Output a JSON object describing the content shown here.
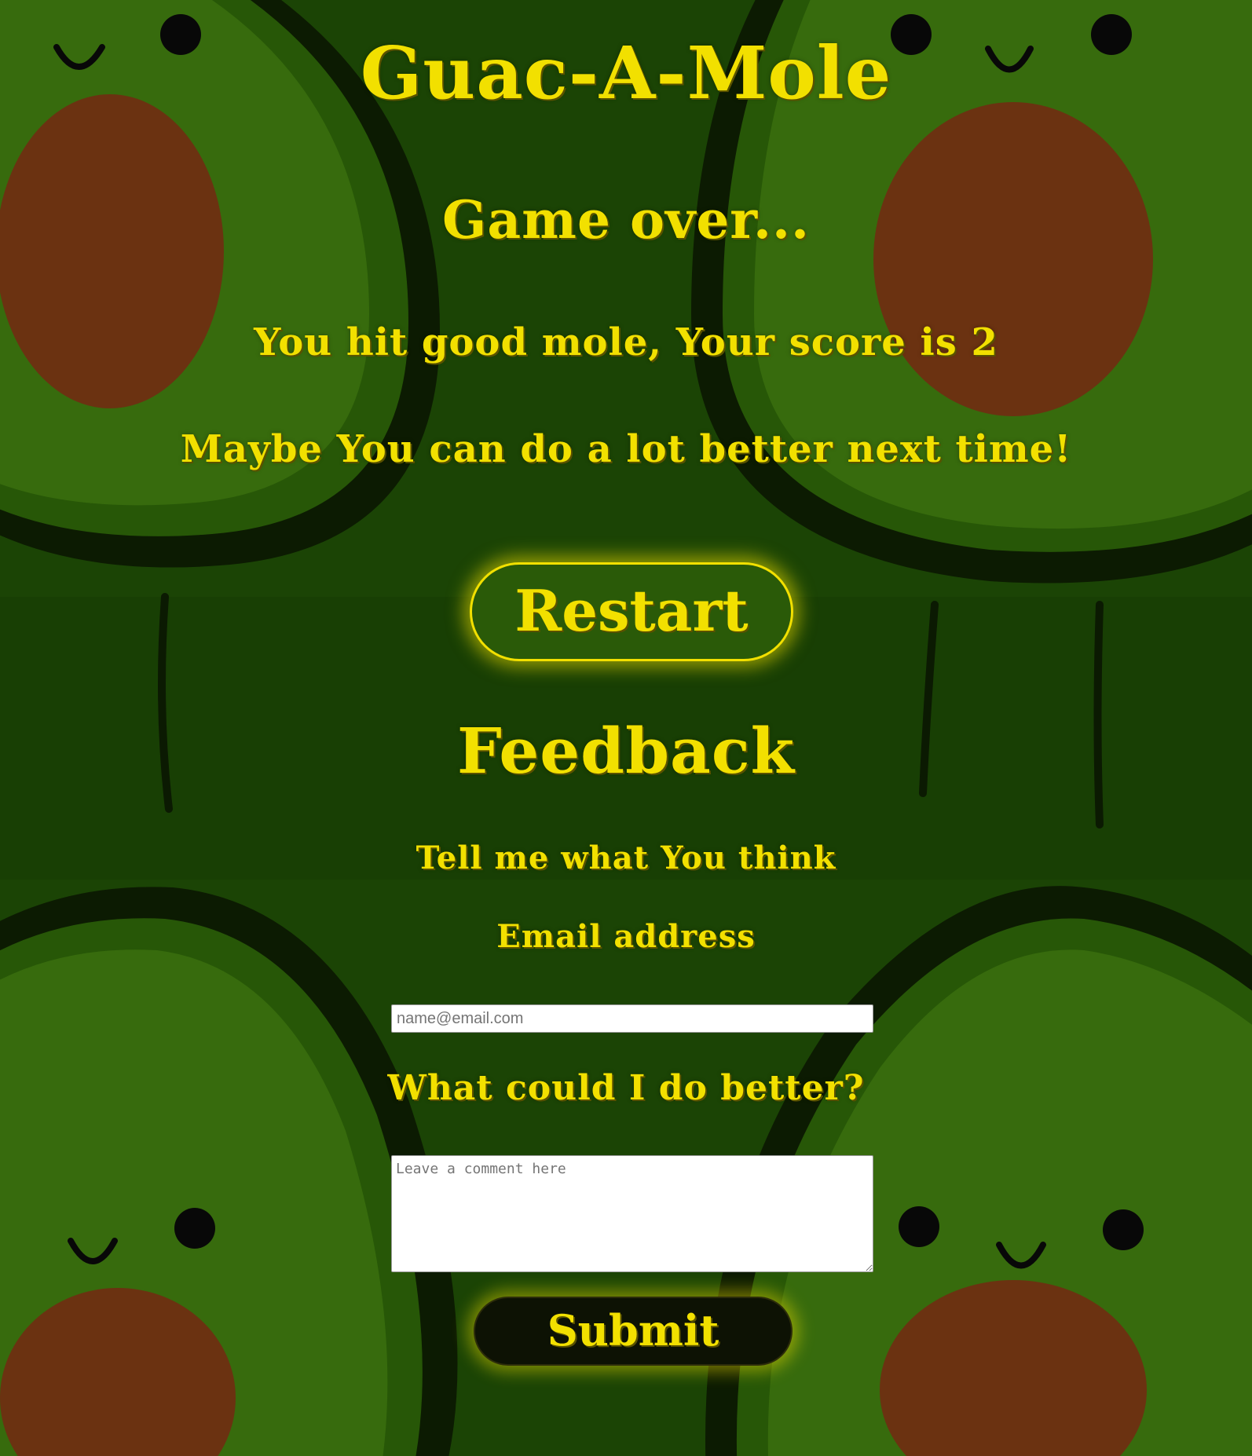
{
  "colors": {
    "accent_yellow": "#f2e000",
    "background_green": "#1f4e06",
    "avocado_flesh": "#3f7a0f",
    "avocado_skin": "#0e1f03",
    "avocado_pit": "#7a3a14"
  },
  "header": {
    "title": "Guac-A-Mole"
  },
  "result": {
    "heading": "Game over...",
    "score_message": "You hit good mole, Your score is 2",
    "encouragement": "Maybe You can do a lot better next time!"
  },
  "restart": {
    "label": "Restart"
  },
  "feedback": {
    "heading": "Feedback",
    "intro": "Tell me what You think",
    "email_label": "Email address",
    "email_placeholder": "name@email.com",
    "email_value": "",
    "comment_label": "What could I do better?",
    "comment_placeholder": "Leave a comment here",
    "comment_value": "",
    "submit_label": "Submit"
  },
  "background": {
    "pattern": "avocado-characters"
  }
}
